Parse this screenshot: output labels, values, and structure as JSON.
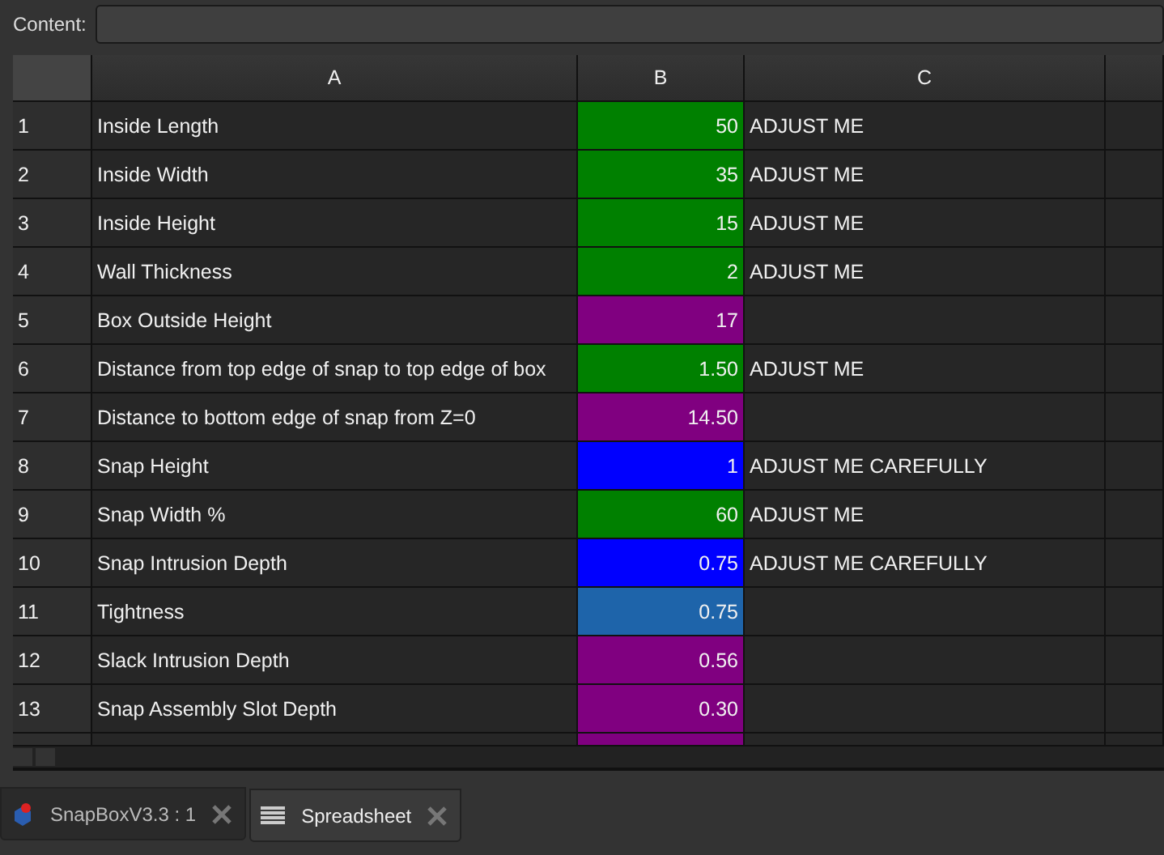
{
  "content_bar": {
    "label": "Content:"
  },
  "table": {
    "columns": [
      "A",
      "B",
      "C"
    ],
    "rows": [
      {
        "number": "1",
        "a": "Inside Length",
        "b": "50",
        "c": "ADJUST ME",
        "color": "#008000"
      },
      {
        "number": "2",
        "a": "Inside Width",
        "b": "35",
        "c": "ADJUST ME",
        "color": "#008000"
      },
      {
        "number": "3",
        "a": "Inside Height",
        "b": "15",
        "c": "ADJUST ME",
        "color": "#008000"
      },
      {
        "number": "4",
        "a": "Wall Thickness",
        "b": "2",
        "c": "ADJUST ME",
        "color": "#008000"
      },
      {
        "number": "5",
        "a": "Box Outside Height",
        "b": "17",
        "color": "#800080"
      },
      {
        "number": "6",
        "a": "Distance from top edge of snap to top edge of box",
        "b": "1.50",
        "c": "ADJUST ME",
        "color": "#008000"
      },
      {
        "number": "7",
        "a": "Distance to bottom edge of snap from Z=0",
        "b": "14.50",
        "color": "#800080"
      },
      {
        "number": "8",
        "a": "Snap Height",
        "b": "1",
        "c": "ADJUST ME CAREFULLY",
        "color": "#0000ff"
      },
      {
        "number": "9",
        "a": "Snap Width %",
        "b": "60",
        "c": "ADJUST ME",
        "color": "#008000"
      },
      {
        "number": "10",
        "a": "Snap Intrusion Depth",
        "b": "0.75",
        "c": "ADJUST ME CAREFULLY",
        "color": "#0000ff"
      },
      {
        "number": "11",
        "a": "Tightness",
        "b": "0.75",
        "color": "#1e64aa"
      },
      {
        "number": "12",
        "a": "Slack Intrusion Depth",
        "b": "0.56",
        "color": "#800080"
      },
      {
        "number": "13",
        "a": "Snap Assembly Slot Depth",
        "b": "0.30",
        "color": "#800080"
      },
      {
        "color": "#800080"
      }
    ]
  },
  "tabs": [
    {
      "label": "SnapBoxV3.3 : 1",
      "kind": "model",
      "selected": false
    },
    {
      "label": "Spreadsheet",
      "kind": "sheet",
      "selected": true
    }
  ]
}
